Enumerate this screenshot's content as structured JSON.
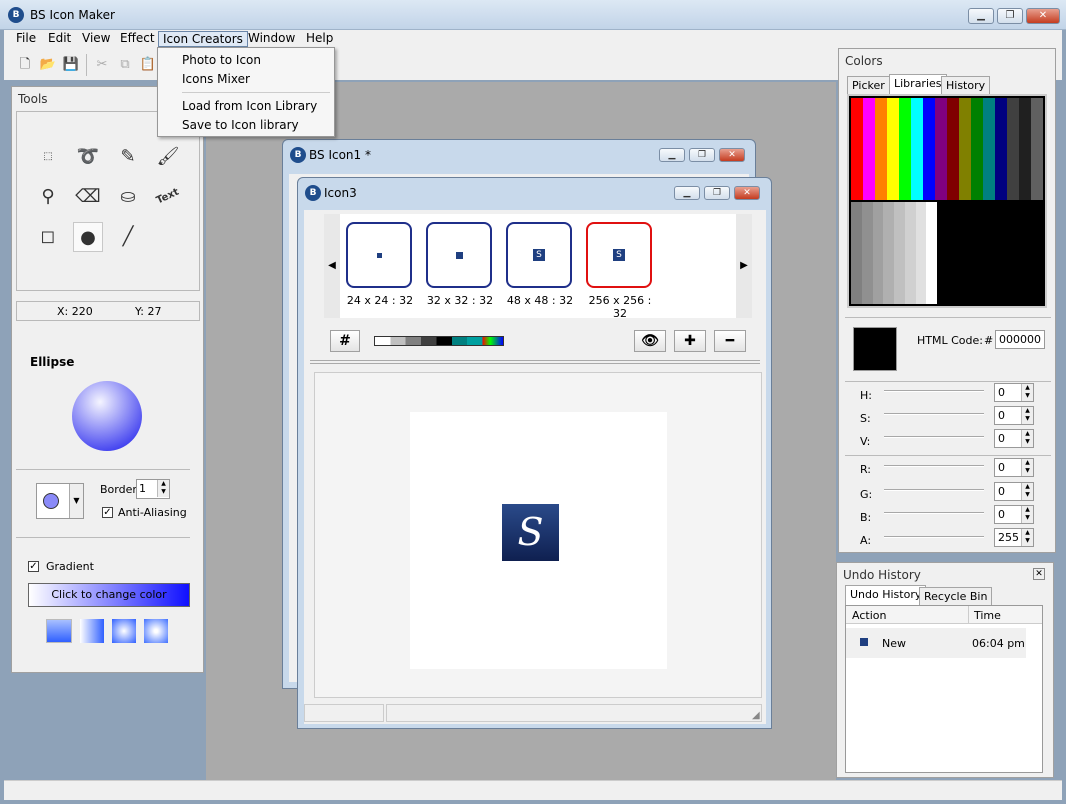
{
  "app": {
    "title": "BS Icon Maker",
    "window_buttons": {
      "min": "▭",
      "max": "⧉",
      "close": "✕"
    }
  },
  "menubar": {
    "items": [
      "File",
      "Edit",
      "View",
      "Effect",
      "Icon Creators",
      "Window",
      "Help"
    ]
  },
  "icon_creators_menu": {
    "items": [
      "Photo to Icon",
      "Icons Mixer",
      "Load from Icon Library",
      "Save to Icon library"
    ]
  },
  "tools_panel": {
    "title": "Tools",
    "text_tool": "Text",
    "coords": {
      "x": "X: 220",
      "y": "Y: 27"
    },
    "shape_name": "Ellipse",
    "border_label": "Border:",
    "border_value": "1",
    "anti_aliasing_label": "Anti-Aliasing",
    "gradient_label": "Gradient",
    "change_color_label": "Click to change color"
  },
  "windows": {
    "bsicon1": {
      "title": "BS Icon1 *"
    },
    "icon3": {
      "title": "Icon3",
      "formats": [
        {
          "label": "24 x 24 : 32"
        },
        {
          "label": "32 x 32 : 32"
        },
        {
          "label": "48 x 48 : 32"
        },
        {
          "label": "256 x 256 : 32"
        }
      ],
      "canvas_glyph": "S"
    }
  },
  "colors_panel": {
    "title": "Colors",
    "tabs": [
      "Picker",
      "Libraries",
      "History"
    ],
    "active_tab": "Libraries",
    "html_code_label": "HTML Code:",
    "hash": "#",
    "html_code_value": "000000",
    "hsv": [
      {
        "label": "H:",
        "value": "0"
      },
      {
        "label": "S:",
        "value": "0"
      },
      {
        "label": "V:",
        "value": "0"
      }
    ],
    "rgba": [
      {
        "label": "R:",
        "value": "0"
      },
      {
        "label": "G:",
        "value": "0"
      },
      {
        "label": "B:",
        "value": "0"
      },
      {
        "label": "A:",
        "value": "255"
      }
    ],
    "swatches_top": [
      "#ff0000",
      "#ff00ff",
      "#ff8000",
      "#ffff00",
      "#00ff00",
      "#00ffff",
      "#0000ff",
      "#800080",
      "#800000",
      "#808000",
      "#008000",
      "#008080",
      "#000080",
      "#404040",
      "#202020",
      "#606060"
    ],
    "swatches_bottom": [
      "#808080",
      "#909090",
      "#a0a0a0",
      "#b0b0b0",
      "#c0c0c0",
      "#d0d0d0",
      "#e0e0e0",
      "#ffffff"
    ]
  },
  "undo_panel": {
    "title": "Undo History",
    "tabs": [
      "Undo History",
      "Recycle Bin"
    ],
    "columns": [
      "Action",
      "Time"
    ],
    "rows": [
      {
        "action": "New",
        "time": "06:04 pm"
      }
    ]
  }
}
